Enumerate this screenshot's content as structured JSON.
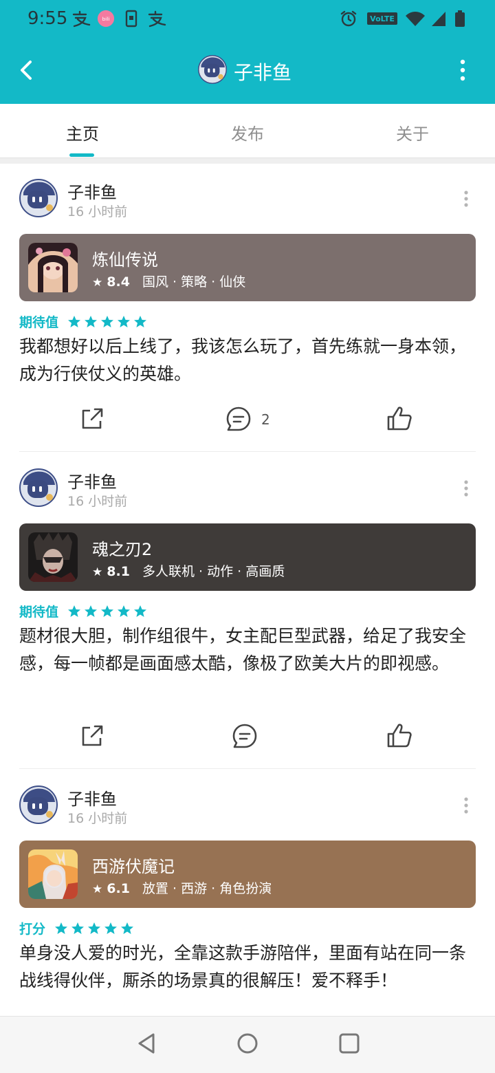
{
  "status_bar": {
    "time": "9:55",
    "lte_label": "VoLTE",
    "icons": [
      "alipay-icon",
      "bilibili-icon",
      "phone-icon",
      "alipay-icon",
      "alarm-icon",
      "volte-icon",
      "wifi-icon",
      "signal-icon",
      "battery-icon"
    ]
  },
  "header": {
    "back_icon": "chevron-left-icon",
    "title": "子非鱼",
    "menu_icon": "more-vertical-icon",
    "accent_color": "#13b9c7"
  },
  "tabs": [
    {
      "label": "主页",
      "active": true
    },
    {
      "label": "发布",
      "active": false
    },
    {
      "label": "关于",
      "active": false
    }
  ],
  "posts": [
    {
      "author": "子非鱼",
      "time": "16 小时前",
      "game": {
        "name": "炼仙传说",
        "score": "8.4",
        "tags": "国风 · 策略 · 仙侠",
        "card_color": "#7c6f6d"
      },
      "rating_label": "期待值",
      "stars": 5,
      "text": "我都想好以后上线了，我该怎么玩了，首先练就一身本领，成为行侠仗义的英雄。",
      "comment_count": "2"
    },
    {
      "author": "子非鱼",
      "time": "16 小时前",
      "game": {
        "name": "魂之刃2",
        "score": "8.1",
        "tags": "多人联机 · 动作 · 高画质",
        "card_color": "#3f3b39"
      },
      "rating_label": "期待值",
      "stars": 5,
      "text": "题材很大胆，制作组很牛，女主配巨型武器，给足了我安全感，每一帧都是画面感太酷，像极了欧美大片的即视感。",
      "comment_count": ""
    },
    {
      "author": "子非鱼",
      "time": "16 小时前",
      "game": {
        "name": "西游伏魔记",
        "score": "6.1",
        "tags": "放置 · 西游 · 角色扮演",
        "card_color": "#977253"
      },
      "rating_label": "打分",
      "stars": 5,
      "text": "单身没人爱的时光，全靠这款手游陪伴，里面有站在同一条战线得伙伴，厮杀的场景真的很解压！爱不释手！",
      "comment_count": ""
    }
  ],
  "bottom_nav": [
    "back-triangle-icon",
    "home-circle-icon",
    "recents-square-icon"
  ]
}
